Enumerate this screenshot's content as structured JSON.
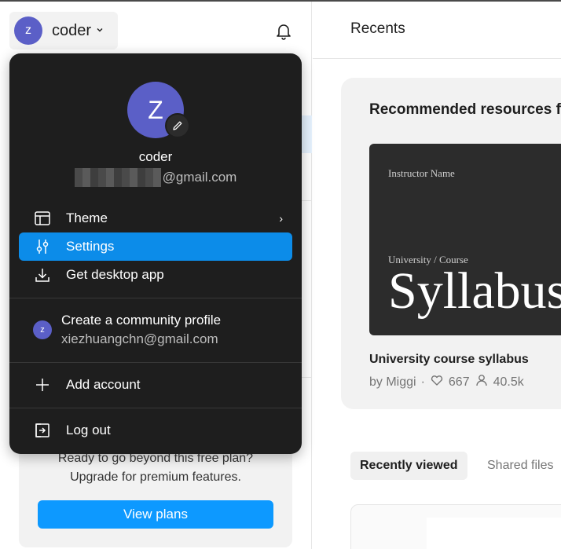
{
  "header": {
    "account_initial": "z",
    "account_name": "coder",
    "chevron": "⌄"
  },
  "icons": {
    "bell": "bell-icon",
    "theme": "layout-icon",
    "settings": "sliders-icon",
    "desktop": "download-icon",
    "add": "plus-icon",
    "logout": "logout-icon",
    "edit": "pencil-icon"
  },
  "menu": {
    "avatar_initial": "Z",
    "name": "coder",
    "email_suffix": "@gmail.com",
    "items": [
      {
        "label": "Theme",
        "chevron": "›"
      },
      {
        "label": "Settings"
      },
      {
        "label": "Get desktop app"
      }
    ],
    "community": {
      "initial": "z",
      "title": "Create a community profile",
      "email": "xiezhuangchn@gmail.com"
    },
    "add_account": "Add account",
    "logout": "Log out"
  },
  "upgrade": {
    "line1": "Ready to go beyond this free plan?",
    "line2": "Upgrade for premium features.",
    "button": "View plans"
  },
  "main": {
    "title": "Recents",
    "recommended_title": "Recommended resources f",
    "resource": {
      "thumb_instructor": "Instructor Name",
      "thumb_course": "University / Course",
      "thumb_big": "Syllabus",
      "name": "University course syllabus",
      "author": "by Miggi",
      "likes": "667",
      "users": "40.5k"
    },
    "tabs": [
      {
        "label": "Recently viewed",
        "active": true
      },
      {
        "label": "Shared files"
      }
    ]
  },
  "colors": {
    "accent": "#0c8ce9",
    "avatar": "#5b5fc7",
    "menu_bg": "#1e1e1e"
  }
}
